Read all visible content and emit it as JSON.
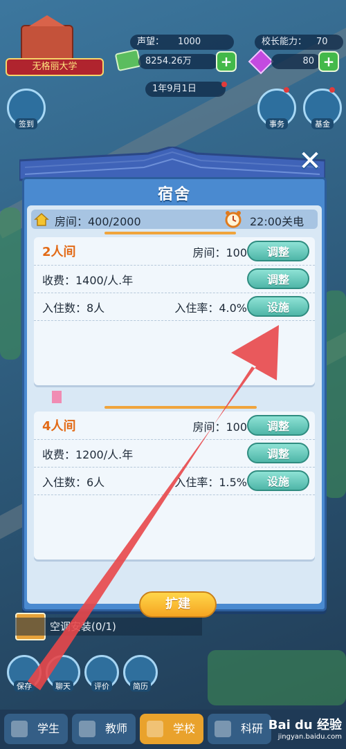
{
  "hud": {
    "school_name": "无格丽大学",
    "reputation_label": "声望：",
    "reputation_value": "1000",
    "principal_label": "校长能力：",
    "principal_value": "70",
    "money": "8254.26万",
    "gems": "80",
    "date": "1年9月1日",
    "left_buttons": [
      "签到"
    ],
    "right_buttons": [
      "事务",
      "基金"
    ]
  },
  "dialog": {
    "title": "宿舍",
    "rooms_summary": "房间：400/2000",
    "power_off": "22:00关电",
    "cards": [
      {
        "type": "2人间",
        "rooms": "房间：100",
        "fee": "收费：1400/人.年",
        "occupants": "入住数：8人",
        "occupancy_rate": "入住率：4.0%",
        "btn_rooms": "调整",
        "btn_fee": "调整",
        "btn_facility": "设施"
      },
      {
        "type": "4人间",
        "rooms": "房间：100",
        "fee": "收费：1200/人.年",
        "occupants": "入住数：6人",
        "occupancy_rate": "入住率：1.5%",
        "btn_rooms": "调整",
        "btn_fee": "调整",
        "btn_facility": "设施"
      }
    ],
    "expand_label": "扩建"
  },
  "task": "空调安装(0/1)",
  "quick_buttons": [
    "保存",
    "聊天",
    "评价",
    "简历"
  ],
  "bottom_nav": [
    {
      "label": "学生"
    },
    {
      "label": "教师"
    },
    {
      "label": "学校"
    },
    {
      "label": "科研"
    }
  ],
  "watermark": {
    "brand": "Bai du 经验",
    "url": "jingyan.baidu.com"
  },
  "colors": {
    "accent_orange": "#e26a16",
    "teal_button": "#4fb6a8",
    "arrow_red": "#e8474a"
  }
}
